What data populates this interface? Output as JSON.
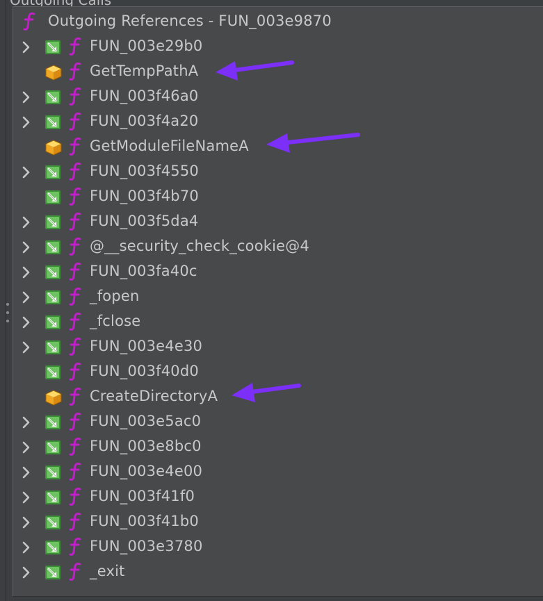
{
  "window": {
    "title": "Outgoing Calls"
  },
  "tree": {
    "root": {
      "label": "Outgoing References - FUN_003e9870"
    },
    "items": [
      {
        "label": "FUN_003e29b0",
        "kind": "function",
        "expandable": true
      },
      {
        "label": "GetTempPathA",
        "kind": "external",
        "expandable": false
      },
      {
        "label": "FUN_003f46a0",
        "kind": "function",
        "expandable": true
      },
      {
        "label": "FUN_003f4a20",
        "kind": "function",
        "expandable": true
      },
      {
        "label": "GetModuleFileNameA",
        "kind": "external",
        "expandable": false
      },
      {
        "label": "FUN_003f4550",
        "kind": "function",
        "expandable": true
      },
      {
        "label": "FUN_003f4b70",
        "kind": "function",
        "expandable": false
      },
      {
        "label": "FUN_003f5da4",
        "kind": "function",
        "expandable": true
      },
      {
        "label": "@__security_check_cookie@4",
        "kind": "function",
        "expandable": true
      },
      {
        "label": "FUN_003fa40c",
        "kind": "function",
        "expandable": true
      },
      {
        "label": "_fopen",
        "kind": "function",
        "expandable": true
      },
      {
        "label": "_fclose",
        "kind": "function",
        "expandable": true
      },
      {
        "label": "FUN_003e4e30",
        "kind": "function",
        "expandable": true
      },
      {
        "label": "FUN_003f40d0",
        "kind": "function",
        "expandable": false
      },
      {
        "label": "CreateDirectoryA",
        "kind": "external",
        "expandable": false
      },
      {
        "label": "FUN_003e5ac0",
        "kind": "function",
        "expandable": true
      },
      {
        "label": "FUN_003e8bc0",
        "kind": "function",
        "expandable": true
      },
      {
        "label": "FUN_003e4e00",
        "kind": "function",
        "expandable": true
      },
      {
        "label": "FUN_003f41f0",
        "kind": "function",
        "expandable": true
      },
      {
        "label": "FUN_003f41b0",
        "kind": "function",
        "expandable": true
      },
      {
        "label": "FUN_003e3780",
        "kind": "function",
        "expandable": true
      },
      {
        "label": "_exit",
        "kind": "function",
        "expandable": true
      }
    ]
  },
  "icons": {
    "expand": "chevron-right-icon",
    "function_call": "green-call-arrow-icon",
    "external": "orange-external-library-icon",
    "function": "function-f-icon"
  },
  "colors": {
    "panel_background": "#47494b",
    "text": "#c8c8c8",
    "function_icon": "#c020c8",
    "call_icon": "#4caf50",
    "external_icon": "#f2b233",
    "annotation_arrow": "#7b2ff7"
  }
}
